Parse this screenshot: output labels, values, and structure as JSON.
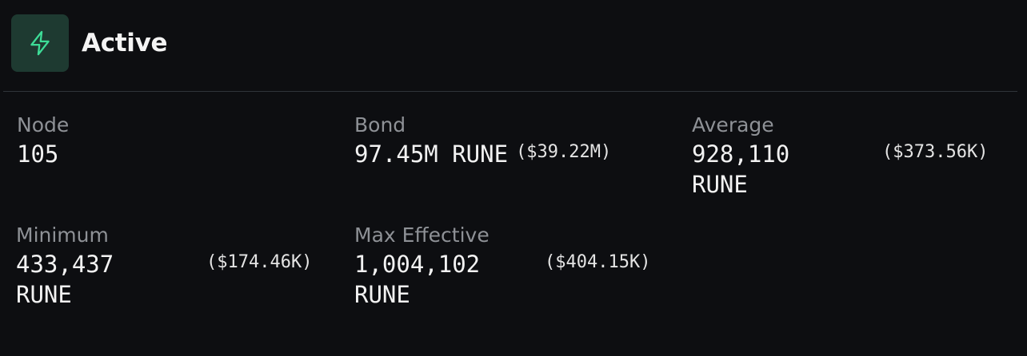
{
  "header": {
    "title": "Active",
    "icon": "lightning-icon",
    "accent_color": "#3ddc97",
    "icon_bg_color": "#1e3a31"
  },
  "stats": {
    "node": {
      "label": "Node",
      "value": "105"
    },
    "bond": {
      "label": "Bond",
      "value": "97.45M RUNE",
      "usd": "($39.22M)"
    },
    "average": {
      "label": "Average",
      "value": "928,110 RUNE",
      "usd": "($373.56K)"
    },
    "minimum": {
      "label": "Minimum",
      "value": "433,437 RUNE",
      "usd": "($174.46K)"
    },
    "max_effective": {
      "label": "Max Effective",
      "value": "1,004,102 RUNE",
      "usd": "($404.15K)"
    }
  }
}
